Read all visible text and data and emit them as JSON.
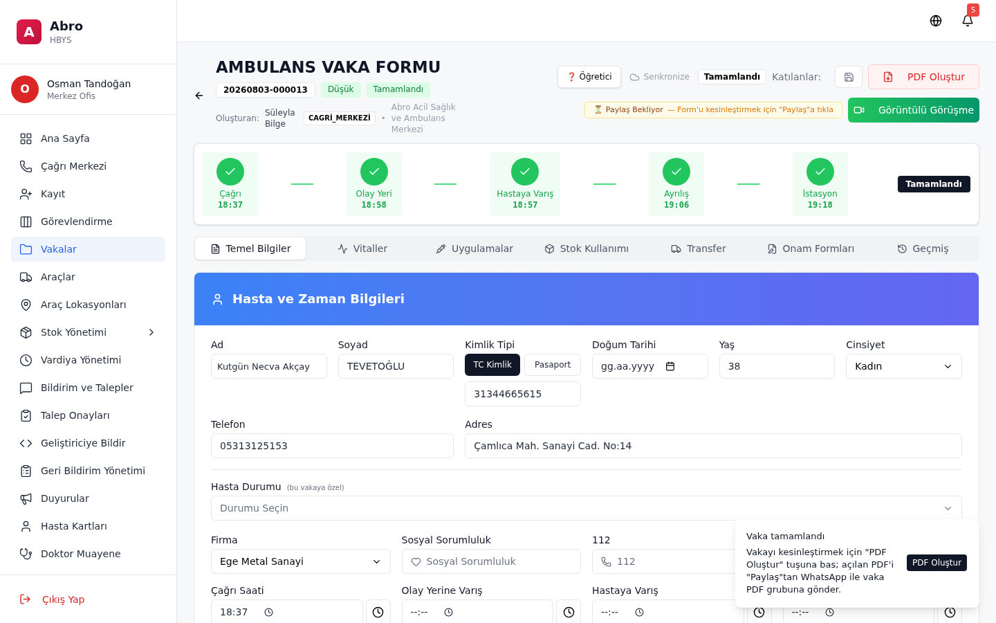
{
  "brand": {
    "logo": "A",
    "name": "Abro",
    "sub": "HBYS"
  },
  "user": {
    "initial": "O",
    "name": "Osman Tandoğan",
    "role": "Merkez Ofis"
  },
  "nav": [
    {
      "label": "Ana Sayfa",
      "selected": false
    },
    {
      "label": "Çağrı Merkezi",
      "selected": false
    },
    {
      "label": "Kayıt",
      "selected": false
    },
    {
      "label": "Görevlendirme",
      "selected": false
    },
    {
      "label": "Vakalar",
      "selected": true
    },
    {
      "label": "Araçlar",
      "selected": false
    },
    {
      "label": "Araç Lokasyonları",
      "selected": false
    },
    {
      "label": "Stok Yönetimi",
      "selected": false,
      "submenu": true
    },
    {
      "label": "Vardiya Yönetimi",
      "selected": false
    },
    {
      "label": "Bildirim ve Talepler",
      "selected": false
    },
    {
      "label": "Talep Onayları",
      "selected": false
    },
    {
      "label": "Geliştiriciye Bildir",
      "selected": false
    },
    {
      "label": "Geri Bildirim Yönetimi",
      "selected": false
    },
    {
      "label": "Duyurular",
      "selected": false
    },
    {
      "label": "Hasta Kartları",
      "selected": false
    },
    {
      "label": "Doktor Muayene",
      "selected": false
    }
  ],
  "logout": "Çıkış Yap",
  "notifications": "5",
  "header": {
    "title": "AMBULANS VAKA FORMU",
    "case_no": "20260803-000013",
    "priority": "Düşük",
    "status": "Tamamlandı",
    "created_by_label": "Oluşturan:",
    "created_by": "Süleyla Bilge",
    "role": "CAGRİ_MERKEZİ",
    "sep": "•",
    "org": "Abro Acil Sağlık ve Ambulans Merkezi"
  },
  "actions": {
    "tutorial": "❓ Öğretici",
    "sync": "Senkronize",
    "state": "Tamamlandı",
    "participants": "Katılanlar:",
    "pdf": "PDF Oluştur",
    "share_status": "⏳ Paylaş Bekliyor",
    "share_hint": "— Form'u kesinleştirmek için \"Paylaş\"a tıkla",
    "video": "Görüntülü Görüşme"
  },
  "steps": [
    {
      "label": "Çağrı",
      "time": "18:37",
      "done": true
    },
    {
      "label": "Olay Yeri",
      "time": "18:58",
      "done": true
    },
    {
      "label": "Hastaya Varış",
      "time": "18:57",
      "done": true
    },
    {
      "label": "Ayrılış",
      "time": "19:06",
      "done": true
    },
    {
      "label": "İstasyon",
      "time": "19:18",
      "done": true
    }
  ],
  "steps_status": "Tamamlandı",
  "tabs": [
    {
      "label": "Temel Bilgiler",
      "selected": true
    },
    {
      "label": "Vitaller",
      "selected": false
    },
    {
      "label": "Uygulamalar",
      "selected": false
    },
    {
      "label": "Stok Kullanımı",
      "selected": false
    },
    {
      "label": "Transfer",
      "selected": false
    },
    {
      "label": "Onam Formları",
      "selected": false
    },
    {
      "label": "Geçmiş",
      "selected": false
    }
  ],
  "section_title": "Hasta ve Zaman Bilgileri",
  "form": {
    "ad": {
      "label": "Ad",
      "value": "Kutgün Necva Akçay"
    },
    "soyad": {
      "label": "Soyad",
      "value": "TEVETOĞLU"
    },
    "kimlik": {
      "label": "Kimlik Tipi",
      "options": [
        {
          "label": "TC Kimlik",
          "selected": true
        },
        {
          "label": "Pasaport",
          "selected": false
        }
      ],
      "value": "31344665615"
    },
    "dogum": {
      "label": "Doğum Tarihi",
      "placeholder": "gg.aa.yyyy"
    },
    "yas": {
      "label": "Yaş",
      "value": "38"
    },
    "cinsiyet": {
      "label": "Cinsiyet",
      "value": "Kadın"
    },
    "telefon": {
      "label": "Telefon",
      "value": "05313125153"
    },
    "adres": {
      "label": "Adres",
      "value": "Çamlıca Mah. Sanayi Cad. No:14"
    },
    "durum": {
      "label": "Hasta Durumu",
      "note": "(bu vakaya özel)",
      "placeholder": "Durumu Seçin"
    },
    "firma": {
      "label": "Firma",
      "value": "Ege Metal Sanayi"
    },
    "sosyal": {
      "label": "Sosyal Sorumluluk",
      "placeholder": "Sosyal Sorumluluk"
    },
    "hat": {
      "label": "112",
      "placeholder": "112"
    },
    "times": [
      {
        "label": "Çağrı Saati",
        "value": "18:37"
      },
      {
        "label": "Olay Yerine Varış",
        "value": "--:--"
      },
      {
        "label": "Hastaya Varış",
        "value": "--:--"
      },
      {
        "value": "--:--"
      }
    ]
  },
  "toast": {
    "title": "Vaka tamamlandı",
    "body": "Vakayı kesinleştirmek için \"PDF Oluştur\" tuşuna bas; açılan PDF'i \"Paylaş\"tan WhatsApp ile vaka PDF grubuna gönder.",
    "button": "PDF Oluştur"
  }
}
